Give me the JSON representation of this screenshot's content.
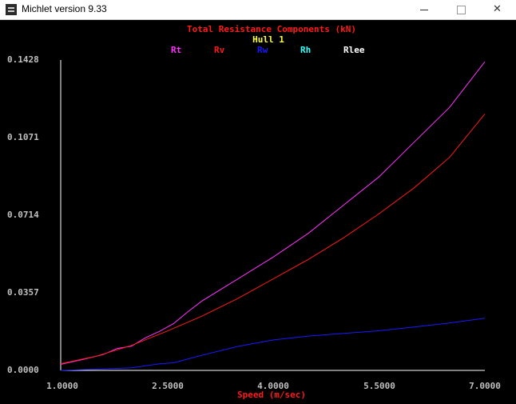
{
  "window": {
    "title": "Michlet version 9.33",
    "icons": {
      "app": "app-icon",
      "minimize": "minimize-icon",
      "maximize": "maximize-icon",
      "close": "close-icon"
    },
    "close_glyph": "✕"
  },
  "chart_data": {
    "type": "line",
    "title": "Total Resistance Components (kN)",
    "subtitle": "Hull 1",
    "xlabel": "Speed (m/sec)",
    "ylabel": "",
    "xlim": [
      1.0,
      7.0
    ],
    "ylim": [
      0.0,
      0.1428
    ],
    "xticks": [
      "1.0000",
      "2.5000",
      "4.0000",
      "5.5000",
      "7.0000"
    ],
    "yticks": [
      "0.0000",
      "0.0357",
      "0.0714",
      "0.1071",
      "0.1428"
    ],
    "grid": false,
    "legend_position": "top",
    "legend": [
      {
        "name": "Rt",
        "color": "#ff33ff"
      },
      {
        "name": "Rv",
        "color": "#ff1a1a"
      },
      {
        "name": "Rw",
        "color": "#1a1aff"
      },
      {
        "name": "Rh",
        "color": "#33ffff"
      },
      {
        "name": "Rlee",
        "color": "#ffffff"
      }
    ],
    "series": [
      {
        "name": "Rt",
        "color": "#ff33ff",
        "x": [
          1.0,
          1.3,
          1.6,
          1.8,
          2.0,
          2.2,
          2.4,
          2.6,
          2.8,
          3.0,
          3.5,
          4.0,
          4.5,
          5.0,
          5.5,
          6.0,
          6.5,
          7.0
        ],
        "y": [
          0.0028,
          0.0049,
          0.0073,
          0.0101,
          0.0111,
          0.015,
          0.018,
          0.0216,
          0.027,
          0.032,
          0.042,
          0.052,
          0.063,
          0.076,
          0.089,
          0.105,
          0.121,
          0.142
        ]
      },
      {
        "name": "Rv",
        "color": "#ff1a1a",
        "x": [
          1.0,
          1.5,
          2.0,
          2.5,
          3.0,
          3.5,
          4.0,
          4.5,
          5.0,
          5.5,
          6.0,
          6.5,
          7.0
        ],
        "y": [
          0.0031,
          0.0065,
          0.0115,
          0.018,
          0.025,
          0.033,
          0.042,
          0.051,
          0.061,
          0.072,
          0.084,
          0.098,
          0.118
        ]
      },
      {
        "name": "Rw",
        "color": "#1a1aff",
        "x": [
          1.0,
          1.5,
          2.0,
          2.4,
          2.6,
          3.0,
          3.5,
          4.0,
          4.5,
          5.0,
          5.5,
          6.0,
          6.5,
          7.0
        ],
        "y": [
          0.0,
          0.0005,
          0.0012,
          0.003,
          0.0035,
          0.007,
          0.011,
          0.014,
          0.0158,
          0.017,
          0.0182,
          0.02,
          0.0218,
          0.024
        ]
      }
    ]
  }
}
